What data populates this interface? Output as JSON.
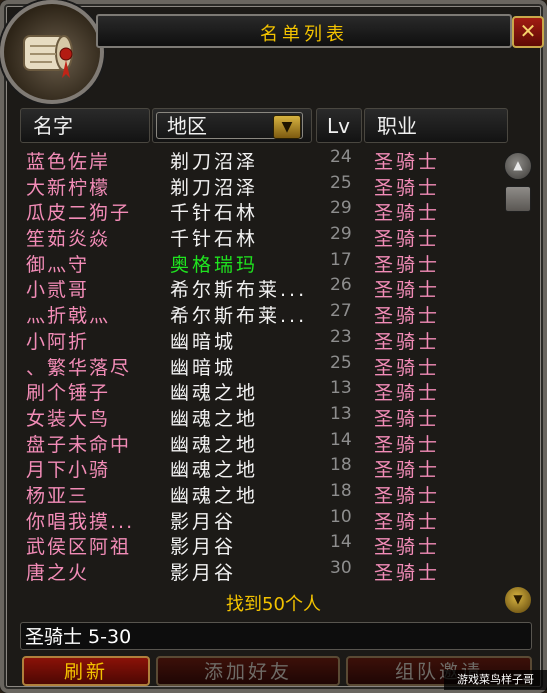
{
  "window": {
    "title": "名单列表",
    "close_glyph": "✕"
  },
  "columns": {
    "name": "名字",
    "zone": "地区",
    "level": "Lv",
    "class": "职业"
  },
  "rows": [
    {
      "name": "蓝色佐岸",
      "zone": "剃刀沼泽",
      "level": "24",
      "class": "圣骑士",
      "zone_color": "white"
    },
    {
      "name": "大新柠檬",
      "zone": "剃刀沼泽",
      "level": "25",
      "class": "圣骑士",
      "zone_color": "white"
    },
    {
      "name": "瓜皮二狗子",
      "zone": "千针石林",
      "level": "29",
      "class": "圣骑士",
      "zone_color": "white"
    },
    {
      "name": "笙茹炎焱",
      "zone": "千针石林",
      "level": "29",
      "class": "圣骑士",
      "zone_color": "white"
    },
    {
      "name": "御灬守",
      "zone": "奥格瑞玛",
      "level": "17",
      "class": "圣骑士",
      "zone_color": "green"
    },
    {
      "name": "小贰哥",
      "zone": "希尔斯布莱...",
      "level": "26",
      "class": "圣骑士",
      "zone_color": "white"
    },
    {
      "name": "灬折戟灬",
      "zone": "希尔斯布莱...",
      "level": "27",
      "class": "圣骑士",
      "zone_color": "white"
    },
    {
      "name": "小阿折",
      "zone": "幽暗城",
      "level": "23",
      "class": "圣骑士",
      "zone_color": "white"
    },
    {
      "name": "、繁华落尽",
      "zone": "幽暗城",
      "level": "25",
      "class": "圣骑士",
      "zone_color": "white"
    },
    {
      "name": "刷个锤子",
      "zone": "幽魂之地",
      "level": "13",
      "class": "圣骑士",
      "zone_color": "white"
    },
    {
      "name": "女装大鸟",
      "zone": "幽魂之地",
      "level": "13",
      "class": "圣骑士",
      "zone_color": "white"
    },
    {
      "name": "盘子未命中",
      "zone": "幽魂之地",
      "level": "14",
      "class": "圣骑士",
      "zone_color": "white"
    },
    {
      "name": "月下小骑",
      "zone": "幽魂之地",
      "level": "18",
      "class": "圣骑士",
      "zone_color": "white"
    },
    {
      "name": "杨亚三",
      "zone": "幽魂之地",
      "level": "18",
      "class": "圣骑士",
      "zone_color": "white"
    },
    {
      "name": "你唱我摸...",
      "zone": "影月谷",
      "level": "10",
      "class": "圣骑士",
      "zone_color": "white"
    },
    {
      "name": "武侯区阿祖",
      "zone": "影月谷",
      "level": "14",
      "class": "圣骑士",
      "zone_color": "white"
    },
    {
      "name": "唐之火",
      "zone": "影月谷",
      "level": "30",
      "class": "圣骑士",
      "zone_color": "white"
    }
  ],
  "found": {
    "prefix": "找到",
    "count": "50",
    "suffix": "个人"
  },
  "search": {
    "value": "圣骑士 5-30"
  },
  "buttons": {
    "refresh": "刷新",
    "add_friend": "添加好友",
    "group_invite": "组队邀请"
  },
  "watermark": "游戏菜鸟样子哥",
  "colors": {
    "title": "#f2c200",
    "player_name": "#f28cb7",
    "zone_default": "#f2f2f2",
    "zone_green": "#1fe41f",
    "level": "#8e8e8e"
  },
  "icons": {
    "portrait": "scroll-icon",
    "close": "close-icon",
    "dropdown": "dropdown-arrow-icon",
    "scroll_up": "scroll-up-icon",
    "scroll_down": "scroll-down-icon"
  }
}
